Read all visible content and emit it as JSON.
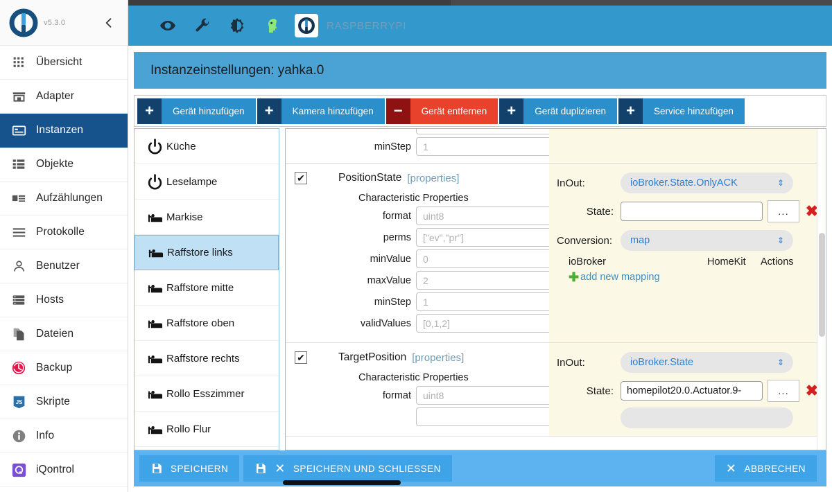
{
  "sidebar": {
    "version": "v5.3.0",
    "collapse_icon": "chevron-left-icon",
    "items": [
      {
        "label": "Übersicht",
        "icon": "grid-icon",
        "active": false
      },
      {
        "label": "Adapter",
        "icon": "store-icon",
        "active": false
      },
      {
        "label": "Instanzen",
        "icon": "instances-icon",
        "active": true
      },
      {
        "label": "Objekte",
        "icon": "list-icon",
        "active": false
      },
      {
        "label": "Aufzählungen",
        "icon": "enum-icon",
        "active": false
      },
      {
        "label": "Protokolle",
        "icon": "lines-icon",
        "active": false
      },
      {
        "label": "Benutzer",
        "icon": "user-icon",
        "active": false
      },
      {
        "label": "Hosts",
        "icon": "server-icon",
        "active": false
      },
      {
        "label": "Dateien",
        "icon": "files-icon",
        "active": false
      },
      {
        "label": "Backup",
        "icon": "backup-icon",
        "active": false
      },
      {
        "label": "Skripte",
        "icon": "javascript-icon",
        "active": false
      },
      {
        "label": "Info",
        "icon": "info-icon",
        "active": false
      },
      {
        "label": "iQontrol",
        "icon": "iqontrol-icon",
        "active": false
      }
    ]
  },
  "appbar": {
    "host": "RASPBERRYPI",
    "icons": [
      "eye-icon",
      "wrench-icon",
      "brightness-icon",
      "expert-head-icon"
    ],
    "logo": "iobroker-logo-icon"
  },
  "page": {
    "title": "Instanzeinstellungen: yahka.0"
  },
  "toolbar": {
    "buttons": [
      {
        "symbol": "+",
        "label": "Gerät hinzufügen",
        "style": "primary"
      },
      {
        "symbol": "+",
        "label": "Kamera hinzufügen",
        "style": "primary"
      },
      {
        "symbol": "−",
        "label": "Gerät entfernen",
        "style": "danger"
      },
      {
        "symbol": "+",
        "label": "Gerät duplizieren",
        "style": "primary"
      },
      {
        "symbol": "+",
        "label": "Service hinzufügen",
        "style": "primary"
      }
    ]
  },
  "devices": [
    {
      "label": "Küche",
      "icon": "power-icon",
      "selected": false
    },
    {
      "label": "Leselampe",
      "icon": "power-icon",
      "selected": false
    },
    {
      "label": "Markise",
      "icon": "blind-icon",
      "selected": false
    },
    {
      "label": "Raffstore links",
      "icon": "blind-icon",
      "selected": true
    },
    {
      "label": "Raffstore mitte",
      "icon": "blind-icon",
      "selected": false
    },
    {
      "label": "Raffstore oben",
      "icon": "blind-icon",
      "selected": false
    },
    {
      "label": "Raffstore rechts",
      "icon": "blind-icon",
      "selected": false
    },
    {
      "label": "Rollo Esszimmer",
      "icon": "blind-icon",
      "selected": false
    },
    {
      "label": "Rollo Flur",
      "icon": "blind-icon",
      "selected": false
    }
  ],
  "partial_top_row": {
    "label": "minStep",
    "value": "1"
  },
  "characteristics": [
    {
      "name": "PositionState",
      "properties_link": "[properties]",
      "checked": true,
      "section_title": "Characteristic Properties",
      "fields": [
        {
          "label": "format",
          "value": "uint8"
        },
        {
          "label": "perms",
          "value": "[\"ev\",\"pr\"]"
        },
        {
          "label": "minValue",
          "value": "0"
        },
        {
          "label": "maxValue",
          "value": "2"
        },
        {
          "label": "minStep",
          "value": "1"
        },
        {
          "label": "validValues",
          "value": "[0,1,2]"
        }
      ],
      "inout_label": "InOut:",
      "inout_value": "ioBroker.State.OnlyACK",
      "state_label": "State:",
      "state_value": "",
      "ellipsis_label": "...",
      "conversion_label": "Conversion:",
      "conversion_value": "map",
      "map_headers": [
        "ioBroker",
        "HomeKit",
        "Actions"
      ],
      "add_mapping_label": "add new mapping"
    },
    {
      "name": "TargetPosition",
      "properties_link": "[properties]",
      "checked": true,
      "section_title": "Characteristic Properties",
      "fields": [
        {
          "label": "format",
          "value": "uint8"
        }
      ],
      "inout_label": "InOut:",
      "inout_value": "ioBroker.State",
      "state_label": "State:",
      "state_value": "homepilot20.0.Actuator.9-",
      "ellipsis_label": "..."
    }
  ],
  "footer": {
    "save_label": "SPEICHERN",
    "save_close_label": "SPEICHERN UND SCHLIESSEN",
    "cancel_label": "ABBRECHEN"
  },
  "colors": {
    "accent": "#3399cc",
    "sidebar_active": "#16528c",
    "danger": "#e8412c",
    "highlight_row": "#fbf8e6",
    "selected_device": "#bfe0f5"
  }
}
